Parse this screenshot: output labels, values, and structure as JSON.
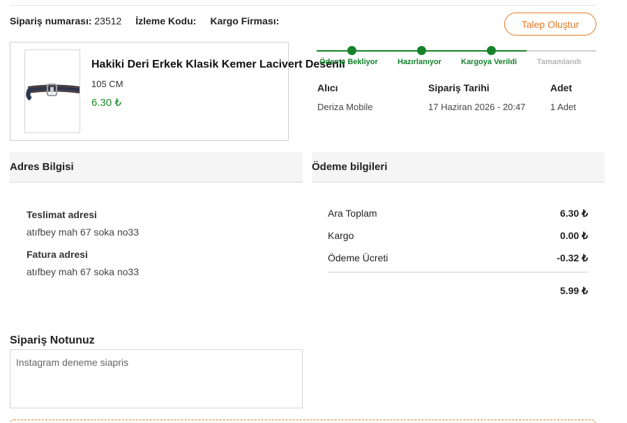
{
  "order": {
    "number_label": "Sipariş numarası:",
    "number_value": "23512",
    "tracking_label": "İzleme Kodu:",
    "tracking_value": "",
    "carrier_label": "Kargo Firması:",
    "carrier_value": ""
  },
  "actions": {
    "request_button": "Talep Oluştur"
  },
  "product": {
    "title": "Hakiki Deri Erkek Klasik Kemer Lacivert Desenli",
    "variant": "105 CM",
    "price": "6.30 ₺"
  },
  "status_steps": [
    {
      "label": "Ödeme Bekliyor",
      "done": true
    },
    {
      "label": "Hazırlanıyor",
      "done": true
    },
    {
      "label": "Kargoya Verildi",
      "done": true
    },
    {
      "label": "Tamamlandı",
      "done": false
    }
  ],
  "details": {
    "recipient_label": "Alıcı",
    "recipient_value": "Deriza Mobile",
    "date_label": "Sipariş Tarihi",
    "date_value": "17 Haziran 2026 - 20:47",
    "qty_label": "Adet",
    "qty_value": "1 Adet"
  },
  "address": {
    "heading": "Adres Bilgisi",
    "delivery_label": "Teslimat adresi",
    "delivery_value": "atıfbey mah 67 soka no33",
    "invoice_label": "Fatura adresi",
    "invoice_value": "atıfbey mah 67 soka no33"
  },
  "payment": {
    "heading": "Ödeme bilgileri",
    "subtotal_label": "Ara Toplam",
    "subtotal_value": "6.30 ₺",
    "shipping_label": "Kargo",
    "shipping_value": "0.00 ₺",
    "fee_label": "Ödeme Ücreti",
    "fee_value": "-0.32 ₺",
    "total_value": "5.99 ₺"
  },
  "note": {
    "heading": "Sipariş Notunuz",
    "value": "Instagram deneme siapris"
  },
  "colors": {
    "accent": "#e87722",
    "success": "#13822b",
    "muted": "#b5b5b5"
  }
}
